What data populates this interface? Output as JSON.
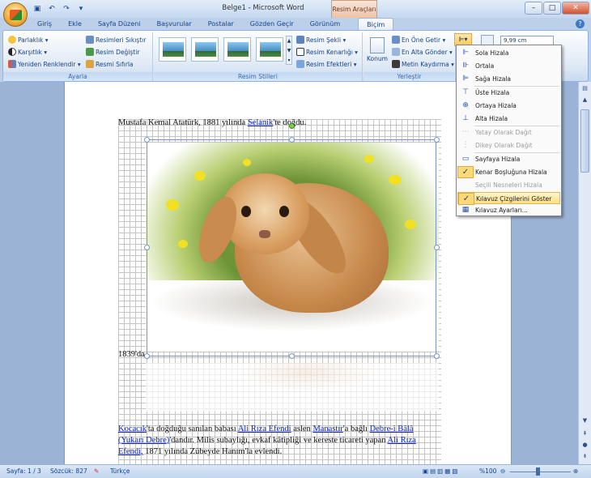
{
  "title_bar": {
    "document_title": "Belge1 - Microsoft Word",
    "context_group": "Resim Araçları",
    "quick_access": [
      "save-icon",
      "undo-icon",
      "redo-icon",
      "customize-icon"
    ]
  },
  "tabs": [
    "Giriş",
    "Ekle",
    "Sayfa Düzeni",
    "Başvurular",
    "Postalar",
    "Gözden Geçir",
    "Görünüm",
    "Biçim"
  ],
  "active_tab": "Biçim",
  "ribbon": {
    "ayarla": {
      "label": "Ayarla",
      "items": [
        "Parlaklık",
        "Karşıtlık",
        "Yeniden Renklendir",
        "Resimleri Sıkıştır",
        "Resim Değiştir",
        "Resmi Sıfırla"
      ]
    },
    "resim_stilleri": {
      "label": "Resim Stilleri",
      "items": [
        "Resim Şekli",
        "Resim Kenarlığı",
        "Resim Efektleri"
      ]
    },
    "yerlestir": {
      "label": "Yerleştir",
      "konum": "Konum",
      "items": [
        "En Öne Getir",
        "En Alta Gönder",
        "Metin Kaydırma"
      ]
    },
    "size": {
      "width": "9,99 cm"
    }
  },
  "align_menu": [
    {
      "label": "Sola Hizala",
      "disabled": false,
      "checked": false,
      "icon": "align-left-icon"
    },
    {
      "label": "Ortala",
      "disabled": false,
      "checked": false,
      "icon": "align-center-icon"
    },
    {
      "label": "Sağa Hizala",
      "disabled": false,
      "checked": false,
      "icon": "align-right-icon"
    },
    {
      "label": "Üste Hizala",
      "disabled": false,
      "checked": false,
      "icon": "align-top-icon"
    },
    {
      "label": "Ortaya Hizala",
      "disabled": false,
      "checked": false,
      "icon": "align-middle-icon"
    },
    {
      "label": "Alta Hizala",
      "disabled": false,
      "checked": false,
      "icon": "align-bottom-icon"
    },
    {
      "label": "Yatay Olarak Dağıt",
      "disabled": true,
      "checked": false,
      "icon": "distribute-horizontal-icon"
    },
    {
      "label": "Dikey Olarak Dağıt",
      "disabled": true,
      "checked": false,
      "icon": "distribute-vertical-icon"
    },
    {
      "label": "Sayfaya Hizala",
      "disabled": false,
      "checked": false,
      "icon": "align-page-icon"
    },
    {
      "label": "Kenar Boşluğuna Hizala",
      "disabled": false,
      "checked": true,
      "icon": "checkmark-icon"
    },
    {
      "label": "Seçili Nesneleri Hizala",
      "disabled": true,
      "checked": false,
      "icon": ""
    },
    {
      "label": "Kılavuz Çizgilerini Göster",
      "disabled": false,
      "checked": true,
      "highlighted": true,
      "icon": "checkmark-icon"
    },
    {
      "label": "Kılavuz Ayarları...",
      "disabled": false,
      "checked": false,
      "icon": "grid-settings-icon"
    }
  ],
  "document": {
    "line1": {
      "text_a": "Mustafa Kemal Atatürk, 1881 yılında ",
      "link": "Selanik",
      "text_b": "'te doğdu."
    },
    "line_1839": "1839'da",
    "para": {
      "l1a": "Kocacık",
      "l1b": "'ta doğduğu sanılan babası ",
      "l1c": "Ali Rıza Efendi",
      "l1d": " aslen ",
      "l1e": "Manastır",
      "l1f": "'a bağlı ",
      "l1g": "Debre-i Bâlâ",
      "l2a": "(Yukarı Debre)",
      "l2b": "'dandır. Milis subaylığı, evkaf kâtipliği ve kereste ticareti yapan ",
      "l2c": "Ali Rıza",
      "l3a": "Efendi,",
      "l3b": " 1871 yılında Zübeyde Hanım'la evlendi."
    }
  },
  "status": {
    "page": "Sayfa: 1 / 3",
    "words": "Sözcük: 827",
    "language": "Türkçe",
    "zoom": "%100"
  }
}
